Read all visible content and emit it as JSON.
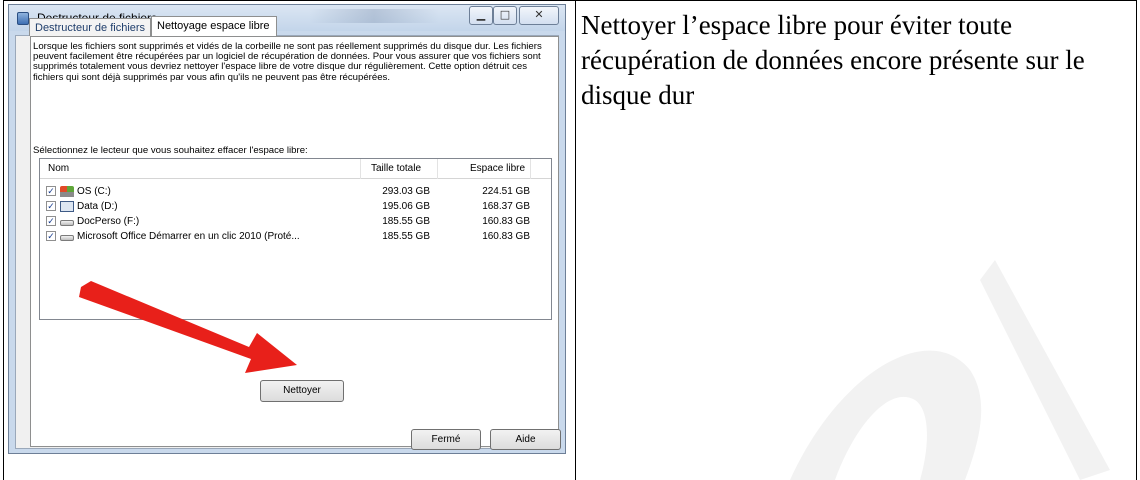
{
  "dialog": {
    "title": "Destructeur de fichiers",
    "window_controls": {
      "minimize_icon": "minimize-icon",
      "maximize_icon": "maximize-icon",
      "close_icon": "close-icon"
    },
    "tabs": [
      {
        "label": "Destructeur de fichiers",
        "active": false
      },
      {
        "label": "Nettoyage espace libre",
        "active": true
      }
    ],
    "description": "Lorsque les fichiers sont supprimés et vidés de la corbeille ne sont pas réellement supprimés du disque dur. Les fichiers peuvent facilement être récupérées par un logiciel de récupération de données. Pour vous assurer que vos fichiers sont supprimés totalement vous devriez nettoyer l'espace libre de votre disque dur régulièrement. Cette option détruit ces fichiers qui sont déjà supprimés par vous afin qu'ils ne peuvent pas être récupérées.",
    "select_label": "Sélectionnez le lecteur que vous souhaitez effacer l'espace libre:",
    "columns": {
      "name": "Nom",
      "size": "Taille totale",
      "free": "Espace libre"
    },
    "drives": [
      {
        "name": "OS (C:)",
        "size": "293.03 GB",
        "free": "224.51 GB",
        "checked": true,
        "icon": "windows-drive-icon"
      },
      {
        "name": "Data (D:)",
        "size": "195.06 GB",
        "free": "168.37 GB",
        "checked": true,
        "icon": "disk-drive-icon"
      },
      {
        "name": "DocPerso (F:)",
        "size": "185.55 GB",
        "free": "160.83 GB",
        "checked": true,
        "icon": "hard-drive-icon"
      },
      {
        "name": "Microsoft Office Démarrer en un clic 2010 (Proté...",
        "size": "185.55 GB",
        "free": "160.83 GB",
        "checked": true,
        "icon": "hard-drive-icon"
      }
    ],
    "buttons": {
      "clean": "Nettoyer",
      "close": "Fermé",
      "help": "Aide"
    },
    "arrow_color": "#e8201a"
  },
  "caption": "Nettoyer l’espace libre pour éviter toute récupération de données encore présente sur le disque dur"
}
